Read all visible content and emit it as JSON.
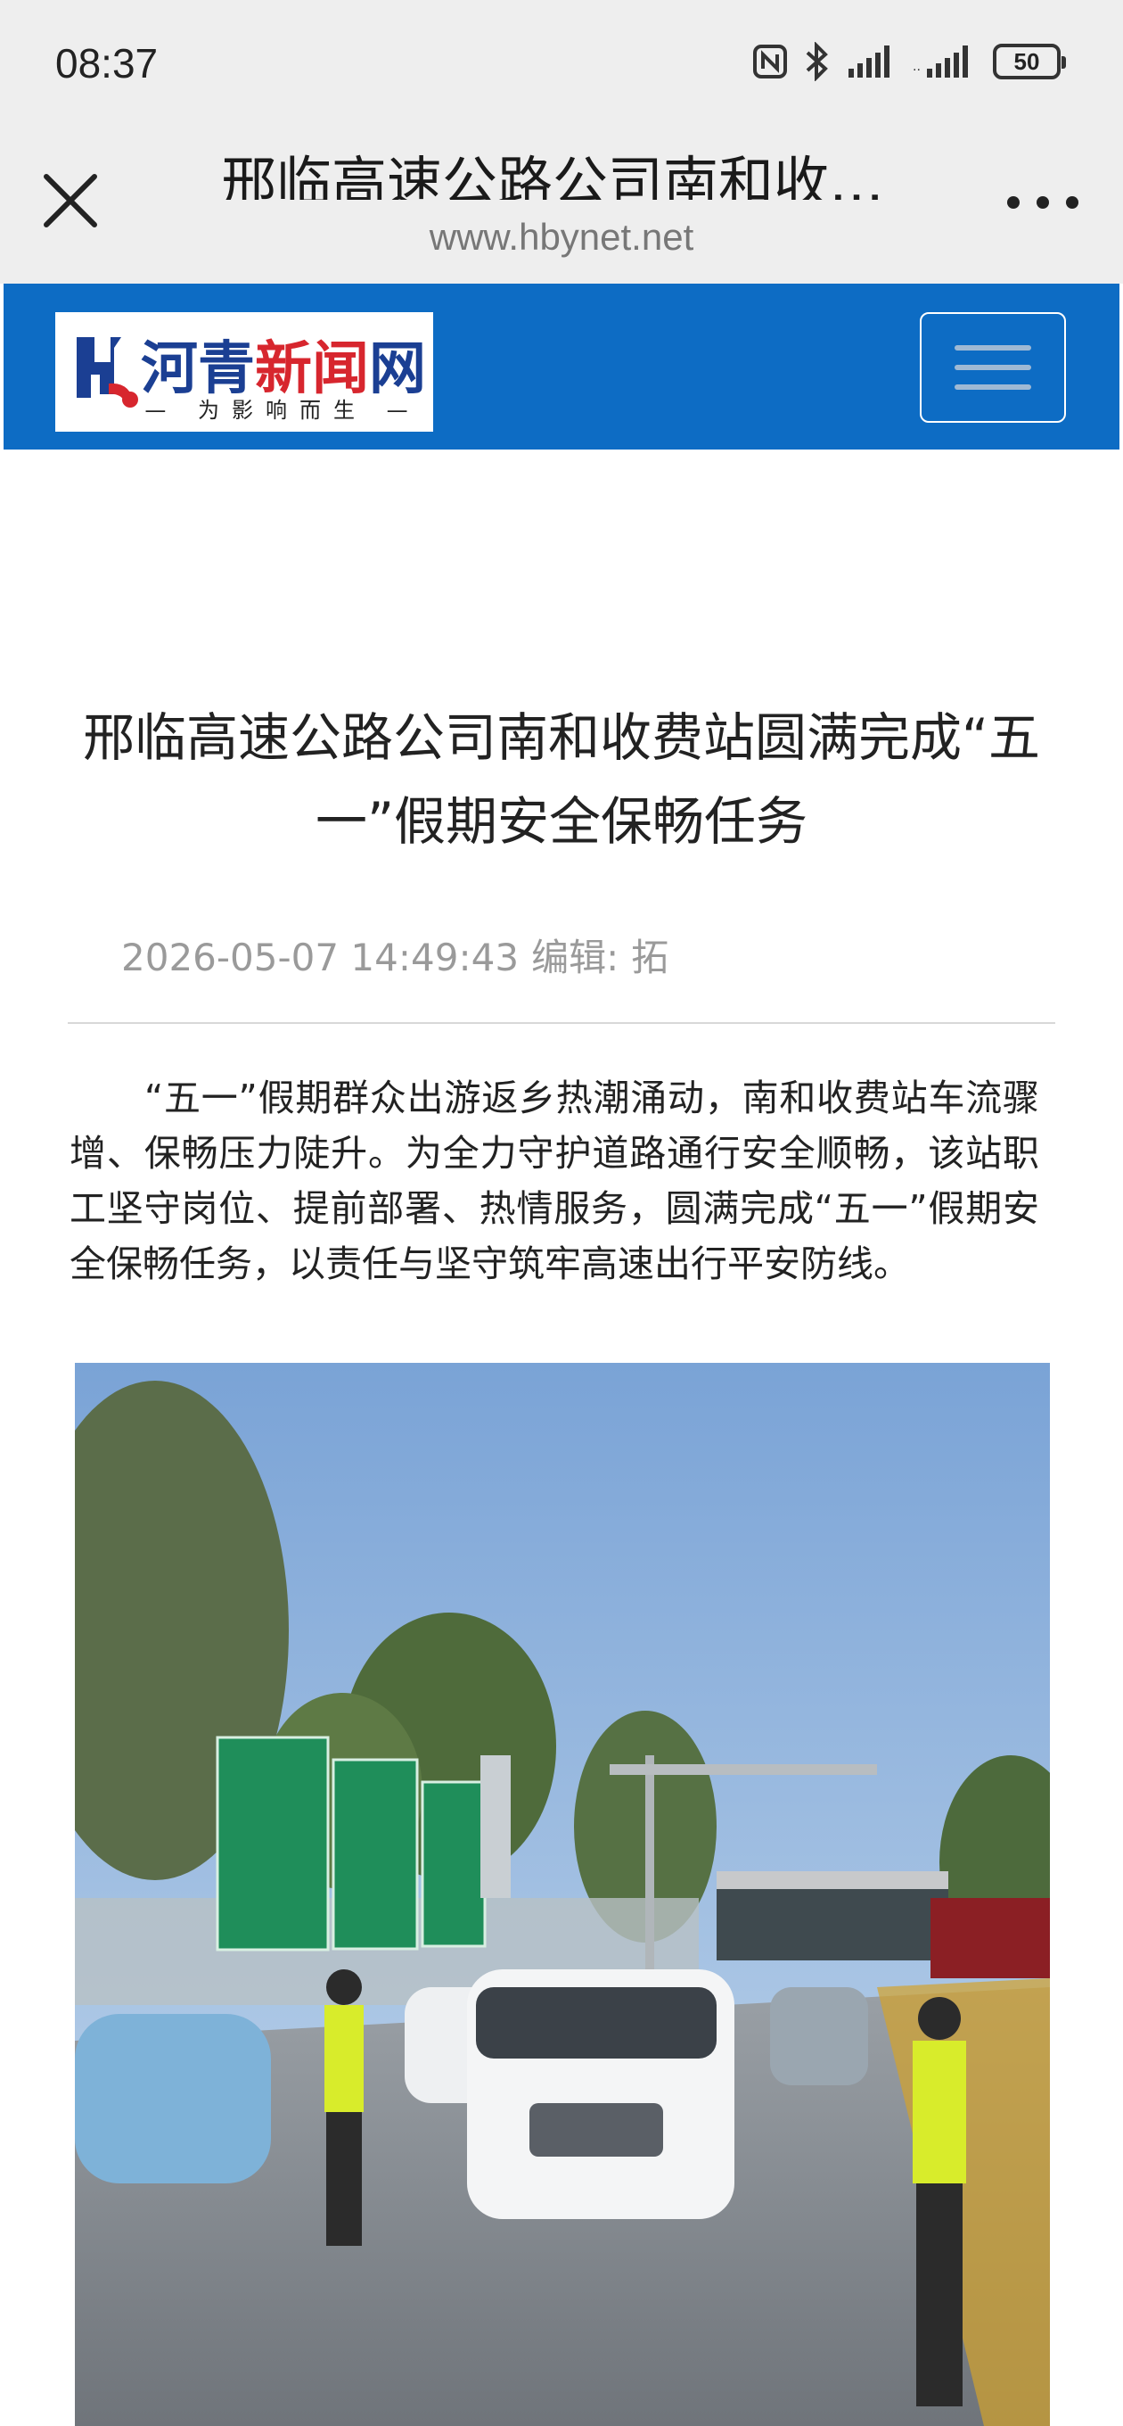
{
  "status_bar": {
    "time": "08:37",
    "battery": "50",
    "icons": [
      "nfc-icon",
      "bluetooth-icon",
      "signal-icon",
      "signal-icon",
      "battery-icon"
    ]
  },
  "title_bar": {
    "title": "邢临高速公路公司南和收…",
    "url": "www.hbynet.net",
    "icons": [
      "close-icon",
      "more-icon"
    ]
  },
  "site_header": {
    "logo_text_blue": "河青",
    "logo_text_red": "新闻",
    "logo_text_blue2": "网",
    "logo_slogan": "为影响而生",
    "brand_color": "#0d6cc4",
    "icons": [
      "menu-icon"
    ]
  },
  "article": {
    "title": "邢临高速公路公司南和收费站圆满完成“五一”假期安全保畅任务",
    "date": "2026-05-07 14:49:43",
    "editor_label": "编辑:",
    "editor": "拓",
    "paragraph": "“五一”假期群众出游返乡热潮涌动，南和收费站车流骤增、保畅压力陡升。为全力守护道路通行安全顺畅，该站职工坚守岗位、提前部署、热情服务，圆满完成“五一”假期安全保畅任务，以责任与坚守筑牢高速出行平安防线。",
    "image_description": ""
  }
}
